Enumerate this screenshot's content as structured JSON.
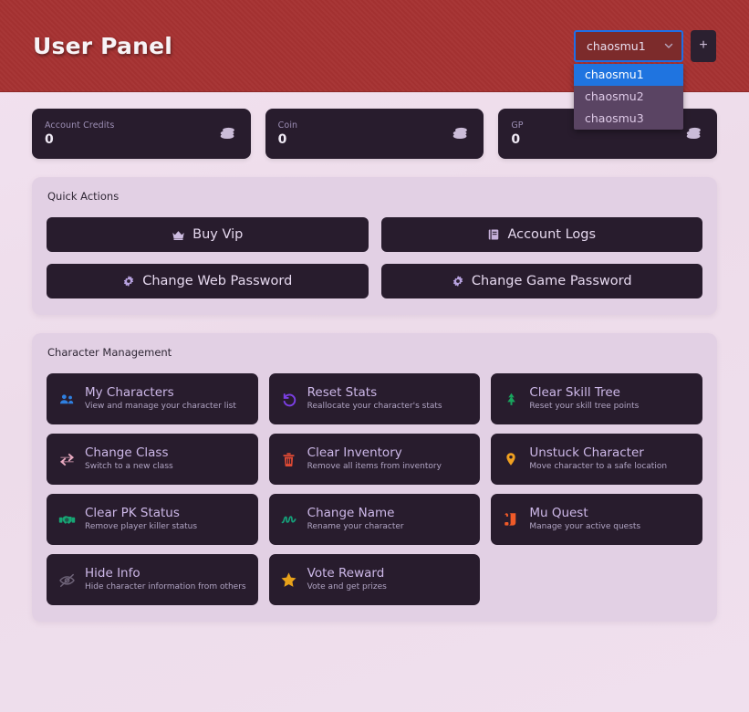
{
  "header": {
    "title": "User Panel",
    "account_select": {
      "icon": "chevron-down-icon",
      "selected": "chaosmu1",
      "options": [
        {
          "label": "chaosmu1",
          "selected": true
        },
        {
          "label": "chaosmu2",
          "selected": false
        },
        {
          "label": "chaosmu3",
          "selected": false
        }
      ]
    },
    "add_button_label": "+",
    "accent_color": "#a63232",
    "focus_color": "#1e6fe8"
  },
  "stats": [
    {
      "label": "Account Credits",
      "value": "0",
      "icon": "coins-icon"
    },
    {
      "label": "Coin",
      "value": "0",
      "icon": "coins-icon"
    },
    {
      "label": "GP",
      "value": "0",
      "icon": "coins-icon"
    }
  ],
  "quick_actions": {
    "title": "Quick Actions",
    "buttons": [
      {
        "label": "Buy Vip",
        "icon": "crown-icon",
        "icon_color": "#cdbce0"
      },
      {
        "label": "Account Logs",
        "icon": "book-icon",
        "icon_color": "#c6b1da"
      },
      {
        "label": "Change Web Password",
        "icon": "gear-icon",
        "icon_color": "#b8a2e0"
      },
      {
        "label": "Change Game Password",
        "icon": "gear-icon",
        "icon_color": "#b8a2e0"
      }
    ]
  },
  "character_management": {
    "title": "Character Management",
    "cards": [
      {
        "title": "My Characters",
        "desc": "View and manage your character list",
        "icon": "users-icon",
        "icon_color": "#2f7fe0"
      },
      {
        "title": "Reset Stats",
        "desc": "Reallocate your character's stats",
        "icon": "undo-icon",
        "icon_color": "#7b3fe4"
      },
      {
        "title": "Clear Skill Tree",
        "desc": "Reset your skill tree points",
        "icon": "tree-icon",
        "icon_color": "#19a55e"
      },
      {
        "title": "Change Class",
        "desc": "Switch to a new class",
        "icon": "swap-arrows-icon",
        "icon_color": "#e8a9c0"
      },
      {
        "title": "Clear Inventory",
        "desc": "Remove all items from inventory",
        "icon": "trash-icon",
        "icon_color": "#e04a34"
      },
      {
        "title": "Unstuck Character",
        "desc": "Move character to a safe location",
        "icon": "map-pin-icon",
        "icon_color": "#f0a020"
      },
      {
        "title": "Clear PK Status",
        "desc": "Remove player killer status",
        "icon": "handshake-icon",
        "icon_color": "#17a574"
      },
      {
        "title": "Change Name",
        "desc": "Rename your character",
        "icon": "signature-icon",
        "icon_color": "#16a07a"
      },
      {
        "title": "Mu Quest",
        "desc": "Manage your active quests",
        "icon": "scroll-icon",
        "icon_color": "#f05a28"
      },
      {
        "title": "Hide Info",
        "desc": "Hide character information from others",
        "icon": "eye-slash-icon",
        "icon_color": "#6e6378"
      },
      {
        "title": "Vote Reward",
        "desc": "Vote and get prizes",
        "icon": "star-icon",
        "icon_color": "#e8a21a"
      }
    ]
  }
}
